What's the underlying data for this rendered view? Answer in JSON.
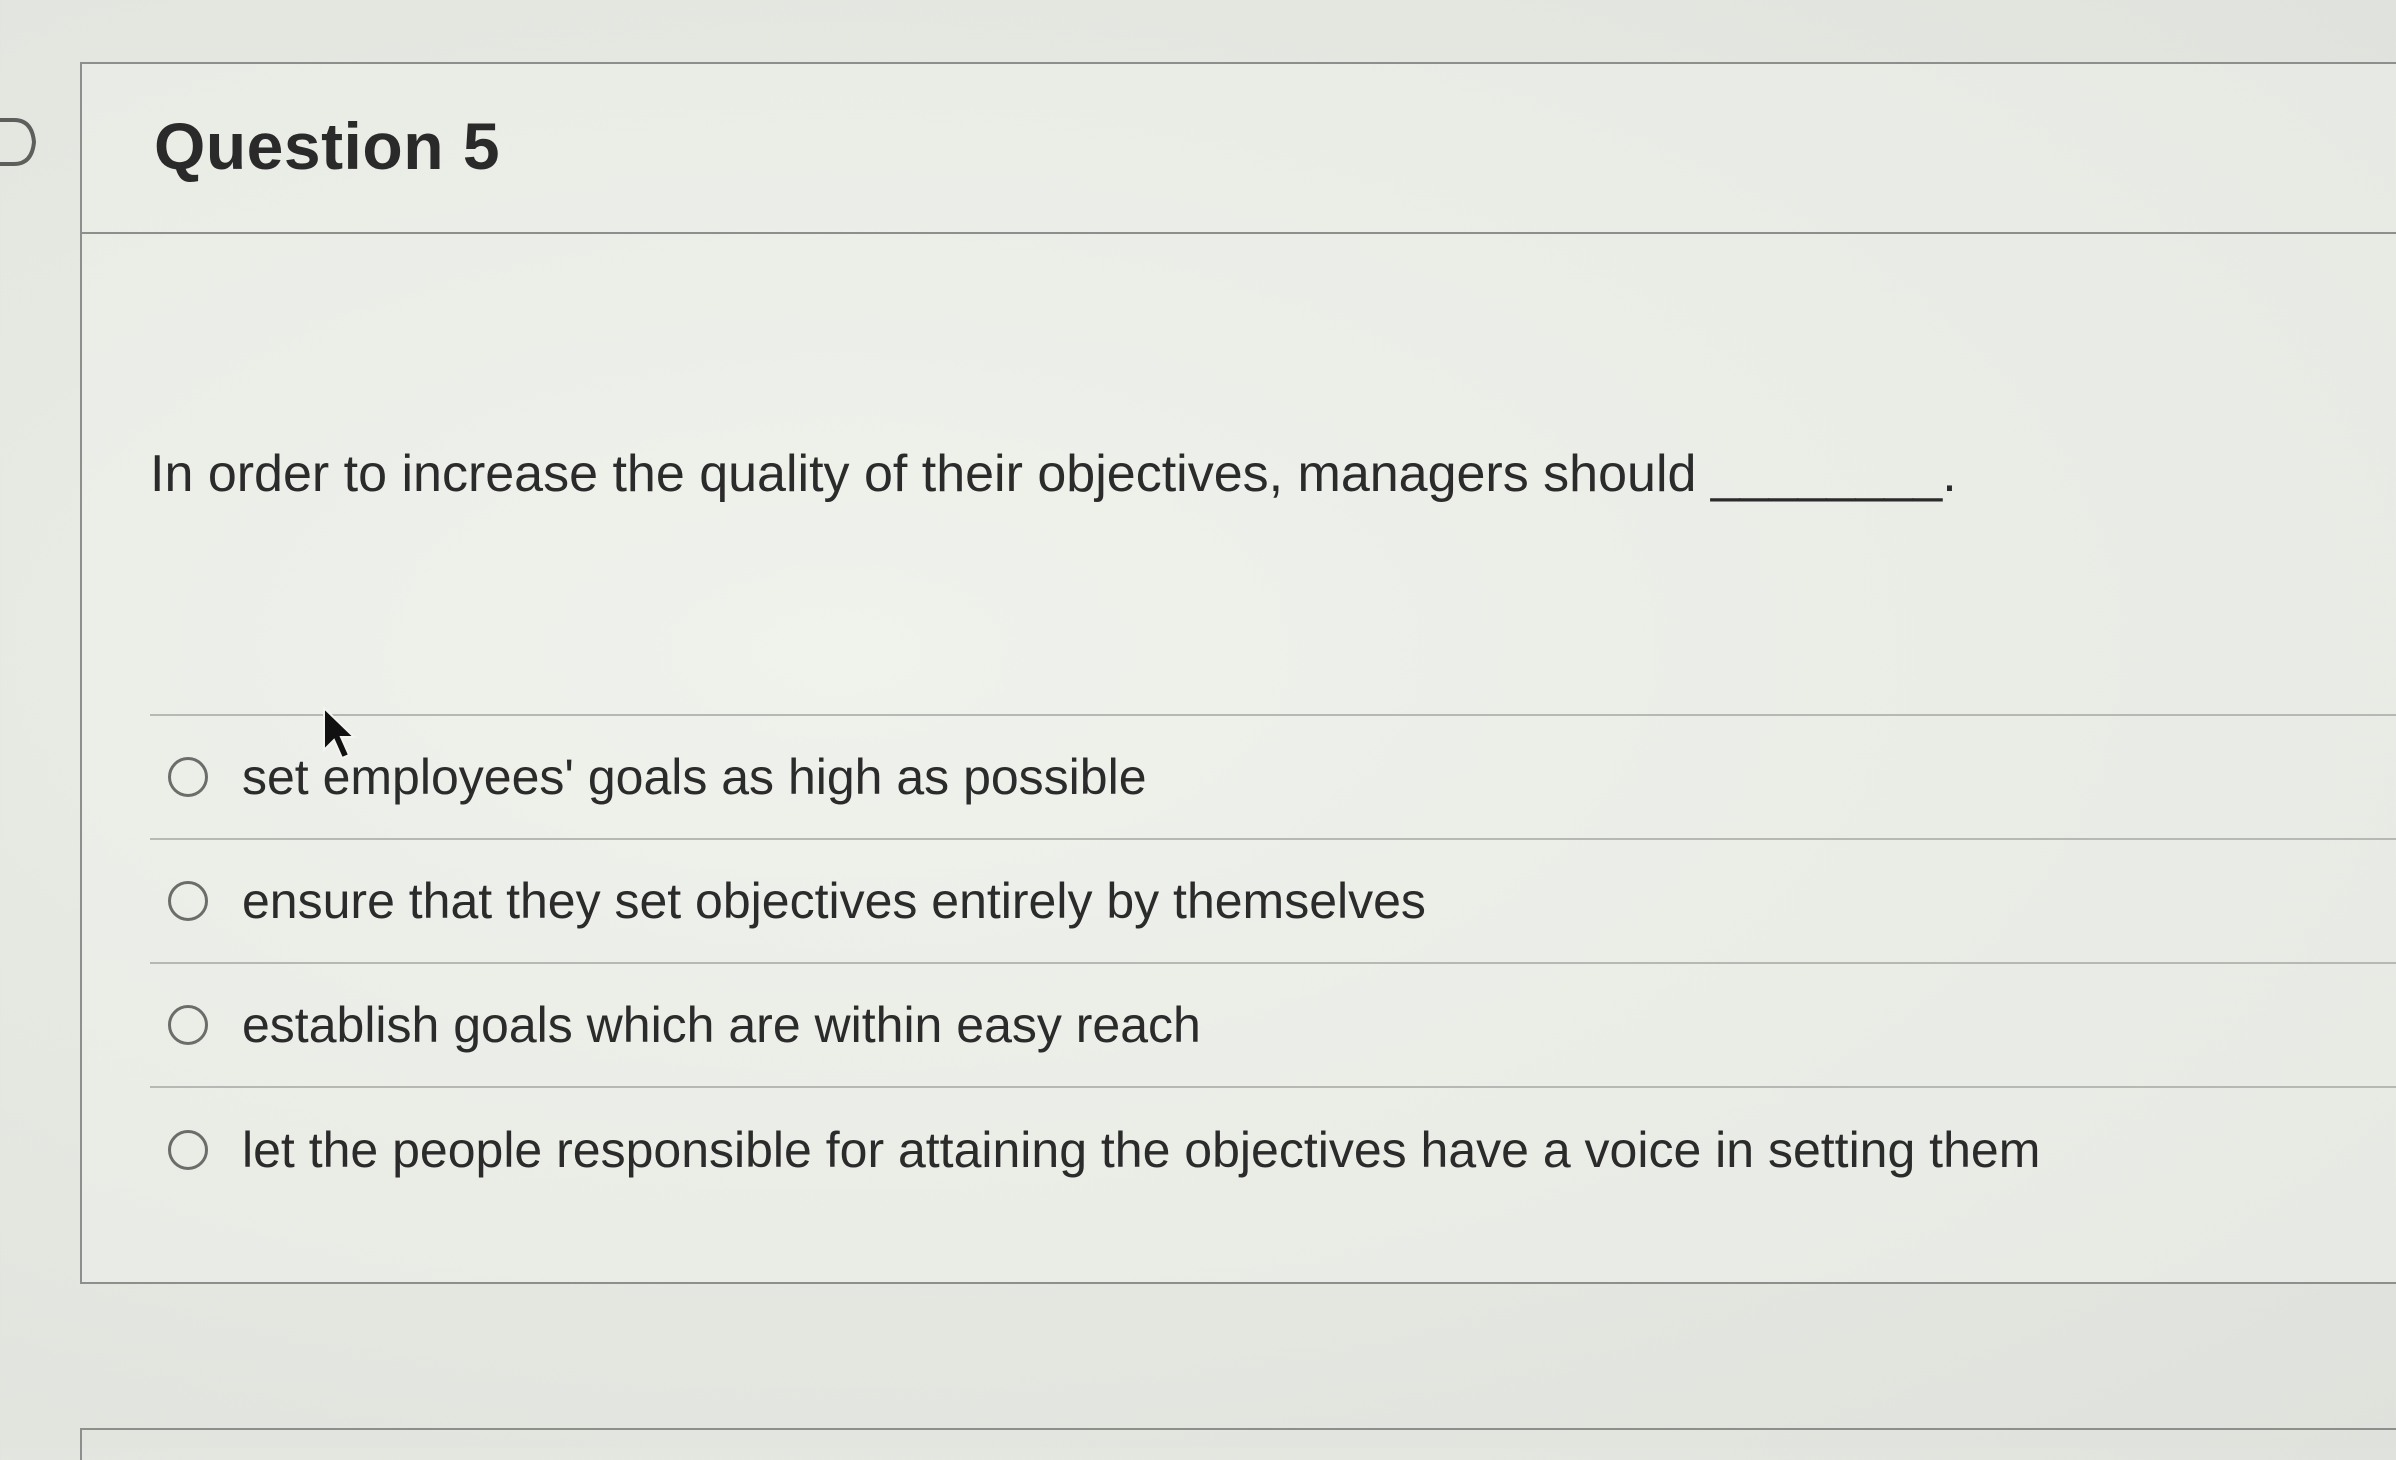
{
  "question": {
    "title": "Question 5",
    "text": "In order to increase the quality of their objectives, managers should ________."
  },
  "answers": [
    {
      "label": "set employees' goals as high as possible",
      "selected": false
    },
    {
      "label": "ensure that they set objectives entirely by themselves",
      "selected": false
    },
    {
      "label": "establish goals which are within easy reach",
      "selected": false
    },
    {
      "label": "let the people responsible for attaining the objectives have a voice in setting them",
      "selected": false
    }
  ],
  "icons": {
    "flag": "flag-question-icon",
    "cursor": "mouse-pointer-icon"
  },
  "colors": {
    "border": "#8d8f8c",
    "text": "#2b2b2b",
    "radio": "#6b6d6a"
  }
}
